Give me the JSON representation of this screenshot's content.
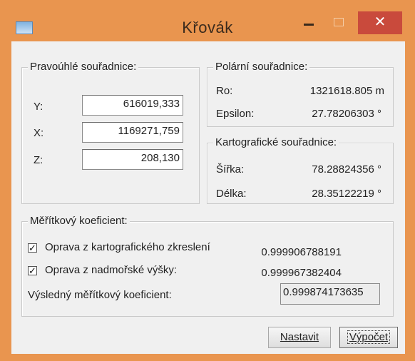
{
  "window": {
    "title": "Křovák",
    "close_glyph": "✕"
  },
  "rectangular": {
    "title": "Pravoúhlé souřadnice:",
    "y_label": "Y:",
    "y_value": "616019,333",
    "x_label": "X:",
    "x_value": "1169271,759",
    "z_label": "Z:",
    "z_value": "208,130"
  },
  "polar": {
    "title": "Polární souřadnice:",
    "ro_label": "Ro:",
    "ro_value": "1321618.805 m",
    "epsilon_label": "Epsilon:",
    "epsilon_value": "27.78206303 °"
  },
  "cartographic": {
    "title": "Kartografické souřadnice:",
    "sirka_label": "Šířka:",
    "sirka_value": "78.28824356 °",
    "delka_label": "Délka:",
    "delka_value": "28.35122219 °"
  },
  "scale": {
    "title": "Měřítkový koeficient:",
    "check1_label": "Oprava z kartografického zkreslení",
    "check1_value": "0.999906788191",
    "check1_checked": true,
    "check2_label": "Oprava z nadmořské výšky:",
    "check2_value": "0.999967382404",
    "check2_checked": true,
    "result_label": "Výsledný měřítkový koeficient:",
    "result_value": "0.999874173635"
  },
  "buttons": {
    "nastavit": "Nastavit",
    "vypocet": "Výpočet"
  },
  "colors": {
    "titlebar": "#e9954f",
    "close_button": "#c94a3c",
    "client": "#f0f0f0"
  }
}
